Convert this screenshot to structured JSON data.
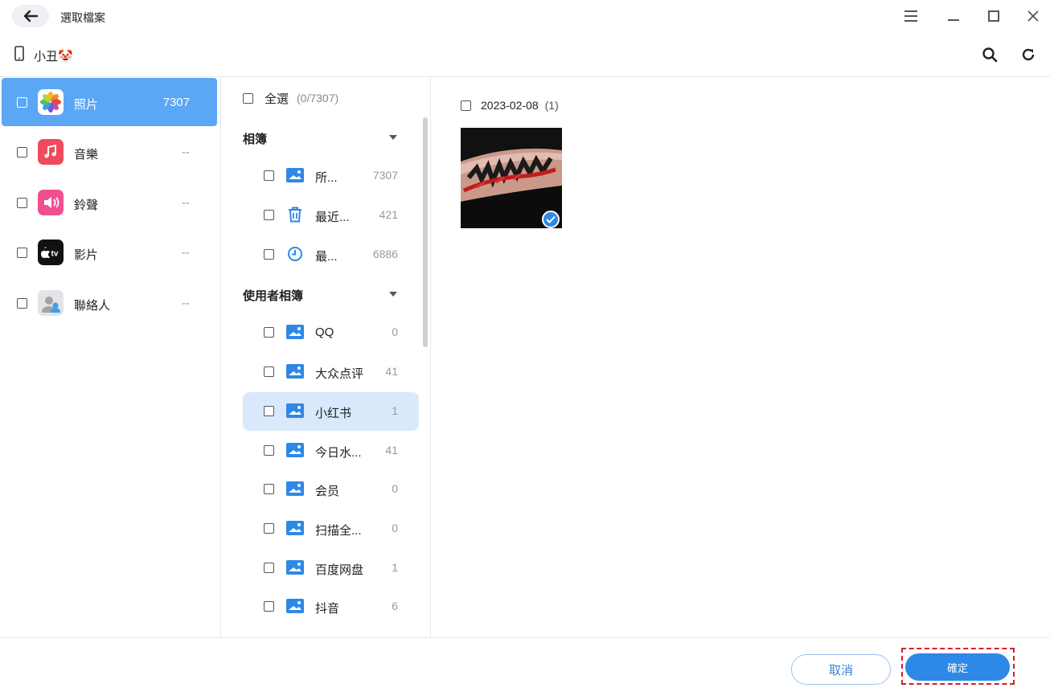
{
  "titlebar": {
    "title": "選取檔案"
  },
  "device": {
    "name": "小丑🤡"
  },
  "categories": [
    {
      "label": "照片",
      "count": "7307",
      "icon": "photos-icon",
      "active": true
    },
    {
      "label": "音樂",
      "count": "--",
      "icon": "music-icon"
    },
    {
      "label": "鈴聲",
      "count": "--",
      "icon": "ringtone-icon"
    },
    {
      "label": "影片",
      "count": "--",
      "icon": "tv-icon"
    },
    {
      "label": "聯絡人",
      "count": "--",
      "icon": "contacts-icon"
    }
  ],
  "albums_panel": {
    "select_all_label": "全選",
    "select_all_count": "(0/7307)",
    "section_albums": "相簿",
    "section_user_albums": "使用者相簿",
    "albums": [
      {
        "label": "所...",
        "count": "7307",
        "icon": "image-icon"
      },
      {
        "label": "最近...",
        "count": "421",
        "icon": "trash-icon"
      },
      {
        "label": "最...",
        "count": "6886",
        "icon": "clock-icon"
      }
    ],
    "user_albums": [
      {
        "label": "QQ",
        "count": "0",
        "icon": "image-icon"
      },
      {
        "label": "大众点评",
        "count": "41",
        "icon": "image-icon"
      },
      {
        "label": "小红书",
        "count": "1",
        "icon": "image-icon",
        "active": true
      },
      {
        "label": "今日水...",
        "count": "41",
        "icon": "image-icon"
      },
      {
        "label": "会员",
        "count": "0",
        "icon": "image-icon"
      },
      {
        "label": "扫描全...",
        "count": "0",
        "icon": "image-icon"
      },
      {
        "label": "百度网盘",
        "count": "1",
        "icon": "image-icon"
      },
      {
        "label": "抖音",
        "count": "6",
        "icon": "image-icon"
      }
    ]
  },
  "photos": {
    "date_label": "2023-02-08",
    "date_count": "(1)",
    "items": [
      {
        "checked": true
      }
    ]
  },
  "footer": {
    "cancel_label": "取消",
    "confirm_label": "確定"
  },
  "colors": {
    "accent": "#2e88e8",
    "active_category": "#5ba7f5",
    "active_album": "#d9e9fb",
    "highlight_border": "#d4202c"
  }
}
